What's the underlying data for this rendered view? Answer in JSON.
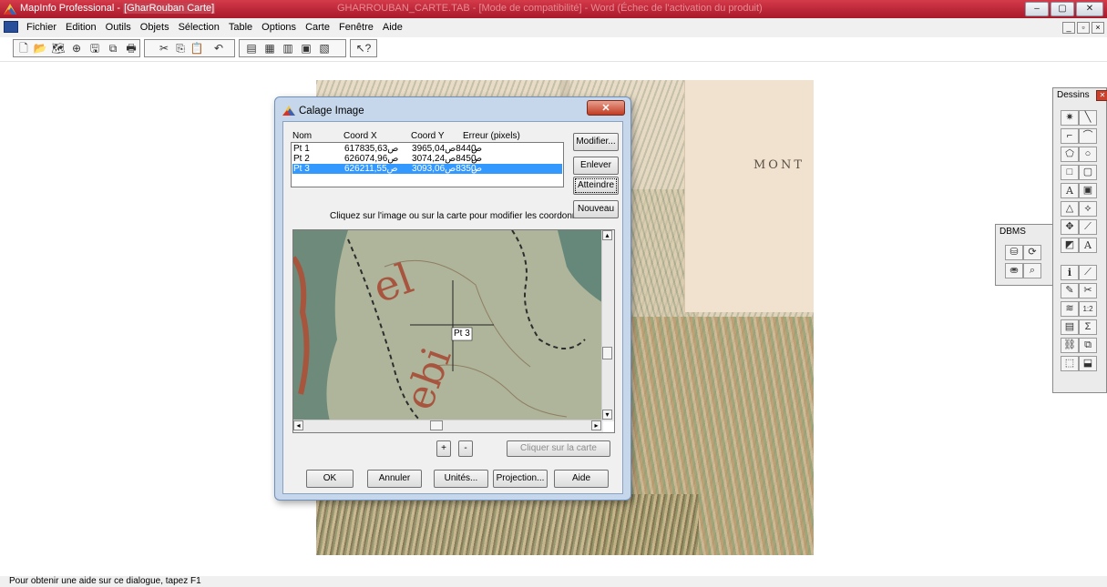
{
  "window": {
    "app_title": "MapInfo Professional - ",
    "doc_title": "[GharRouban Carte]",
    "ghost_title": "GHARROUBAN_CARTE.TAB - [Mode de compatibilité] - Word (Échec de l'activation du produit)",
    "min_label": "–",
    "max_label": "▢",
    "close_label": "✕",
    "mdi_min": "_",
    "mdi_restore": "▫",
    "mdi_close": "×"
  },
  "menu": [
    "Fichier",
    "Edition",
    "Outils",
    "Objets",
    "Sélection",
    "Table",
    "Options",
    "Carte",
    "Fenêtre",
    "Aide"
  ],
  "map": {
    "label": "MONT"
  },
  "dialog": {
    "title": "Calage Image",
    "close_label": "✕",
    "columns": {
      "nom": "Nom",
      "x": "Coord X",
      "y": "Coord Y",
      "err": "Erreur (pixels)"
    },
    "points": [
      {
        "nom": "Pt 1",
        "x": "617ص835,63",
        "y": "3ص844ص965,04",
        "err": "0"
      },
      {
        "nom": "Pt 2",
        "x": "626ص074,96",
        "y": "3ص845ص074,24",
        "err": "0"
      },
      {
        "nom": "Pt 3",
        "x": "626ص211,55",
        "y": "3ص835ص093,06",
        "err": "0"
      }
    ],
    "buttons": {
      "modifier": "Modifier...",
      "enlever": "Enlever",
      "atteindre": "Atteindre",
      "nouveau": "Nouveau",
      "plus": "+",
      "minus": "-",
      "cliquer": "Cliquer sur la carte",
      "ok": "OK",
      "annuler": "Annuler",
      "unites": "Unités...",
      "projection": "Projection...",
      "aide": "Aide"
    },
    "hint": "Cliquez sur l'image ou sur la carte pour modifier les coordonnées",
    "marker_label": "Pt 3"
  },
  "dbms": {
    "title": "DBMS"
  },
  "dessins": {
    "title": "Dessins"
  },
  "status": "Pour obtenir une aide sur ce dialogue, tapez F1"
}
